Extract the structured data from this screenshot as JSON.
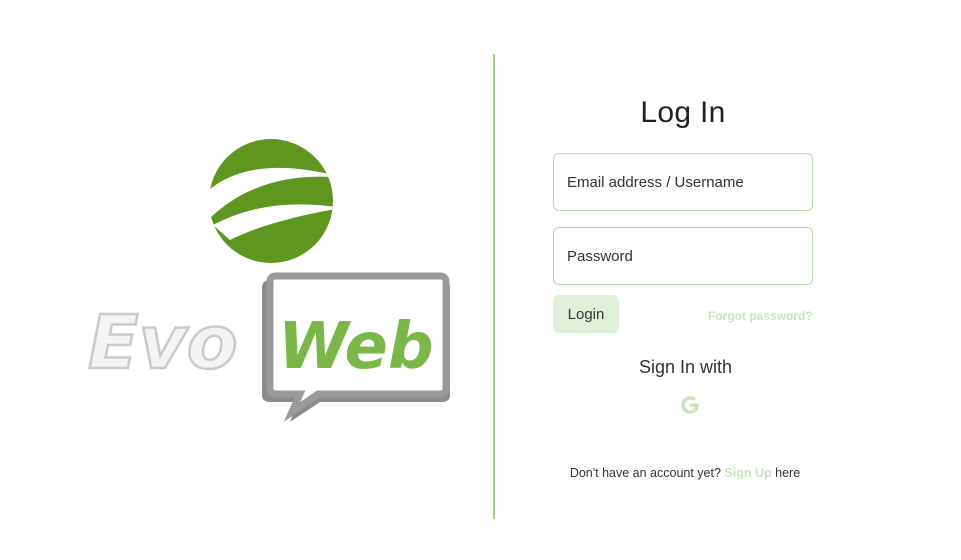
{
  "brand": {
    "logo_text_evo": "Evo",
    "logo_text_web": "Web",
    "green": "#5e961f",
    "light_green": "#7ab648"
  },
  "login": {
    "title": "Log In",
    "email_placeholder": "Email address / Username",
    "password_placeholder": "Password",
    "login_label": "Login",
    "forgot_label": "Forgot password?",
    "signin_with_label": "Sign In with",
    "google_icon": "google-icon",
    "signup_prefix": "Don't have an account yet?",
    "signup_link": "Sign Up",
    "signup_suffix": "here"
  }
}
